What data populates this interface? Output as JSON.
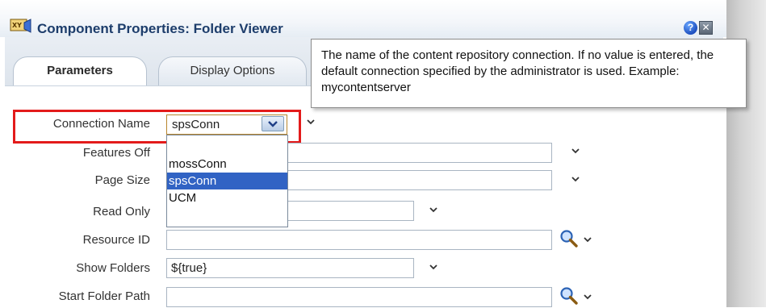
{
  "dialog": {
    "title": "Component Properties: Folder Viewer",
    "icons": {
      "title_icon": "xsl-component-icon",
      "help": "help-icon",
      "close": "close-icon",
      "help_glyph": "?",
      "close_glyph": "✕"
    }
  },
  "tabs": [
    {
      "label": "Parameters",
      "active": true
    },
    {
      "label": "Display Options",
      "active": false
    }
  ],
  "tooltip": {
    "text": "The name of the content repository connection. If no value is entered, the default connection specified by the administrator is used. Example: mycontentserver"
  },
  "fields": {
    "connection_name": {
      "label": "Connection Name",
      "value": "spsConn"
    },
    "features_off": {
      "label": "Features Off",
      "value": ""
    },
    "page_size": {
      "label": "Page Size",
      "value": ""
    },
    "read_only": {
      "label": "Read Only",
      "value": ""
    },
    "resource_id": {
      "label": "Resource ID",
      "value": ""
    },
    "show_folders": {
      "label": "Show Folders",
      "value": "${true}"
    },
    "start_folder_path": {
      "label": "Start Folder Path",
      "value": ""
    }
  },
  "dropdown": {
    "options": [
      "",
      "mossConn",
      "spsConn",
      "UCM"
    ],
    "selected": "spsConn"
  },
  "colors": {
    "title": "#1d3d6b",
    "highlight_box": "#e31b1b",
    "selected_option": "#3163c4"
  }
}
